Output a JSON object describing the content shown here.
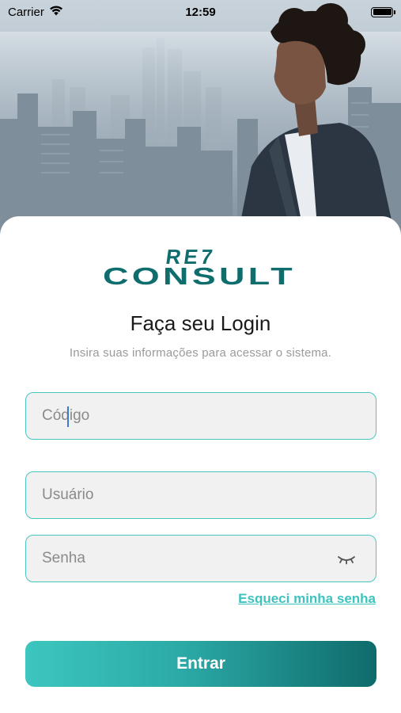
{
  "status_bar": {
    "carrier": "Carrier",
    "time": "12:59"
  },
  "logo": {
    "line1": "RE7",
    "line2": "CONSULT"
  },
  "login": {
    "title": "Faça seu Login",
    "subtitle": "Insira suas informações para acessar o sistema.",
    "code_placeholder": "Código",
    "user_placeholder": "Usuário",
    "password_placeholder": "Senha",
    "forgot_label": "Esqueci minha senha",
    "submit_label": "Entrar"
  },
  "colors": {
    "accent": "#48c5c1",
    "button_start": "#3cc6bf",
    "button_end": "#0f6b6b",
    "logo": "#0f6d6d"
  },
  "icons": [
    "wifi-icon",
    "battery-icon",
    "eye-closed-icon"
  ]
}
